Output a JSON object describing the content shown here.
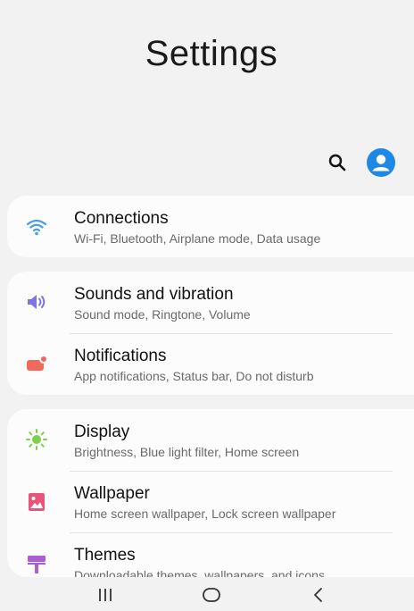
{
  "header": {
    "title": "Settings"
  },
  "toolbar": {
    "search_icon": "search-icon",
    "account_icon": "account-icon"
  },
  "groups": [
    {
      "items": [
        {
          "title": "Connections",
          "subtitle": "Wi-Fi, Bluetooth, Airplane mode, Data usage",
          "icon": "wifi-icon",
          "color": "#4a9de8"
        }
      ]
    },
    {
      "items": [
        {
          "title": "Sounds and vibration",
          "subtitle": "Sound mode, Ringtone, Volume",
          "icon": "speaker-icon",
          "color": "#7f74e6"
        },
        {
          "title": "Notifications",
          "subtitle": "App notifications, Status bar, Do not disturb",
          "icon": "notification-icon",
          "color": "#ef6a5a"
        }
      ]
    },
    {
      "items": [
        {
          "title": "Display",
          "subtitle": "Brightness, Blue light filter, Home screen",
          "icon": "brightness-icon",
          "color": "#7ed04a"
        },
        {
          "title": "Wallpaper",
          "subtitle": "Home screen wallpaper, Lock screen wallpaper",
          "icon": "wallpaper-icon",
          "color": "#e7567a"
        },
        {
          "title": "Themes",
          "subtitle": "Downloadable themes, wallpapers, and icons",
          "icon": "themes-icon",
          "color": "#a95fd0"
        }
      ]
    }
  ],
  "navbar": {
    "recents_icon": "recents-icon",
    "home_icon": "home-icon",
    "back_icon": "back-icon"
  },
  "colors": {
    "background": "#f2f2f2",
    "card": "#fcfcfc",
    "accent": "#1e88e5"
  }
}
